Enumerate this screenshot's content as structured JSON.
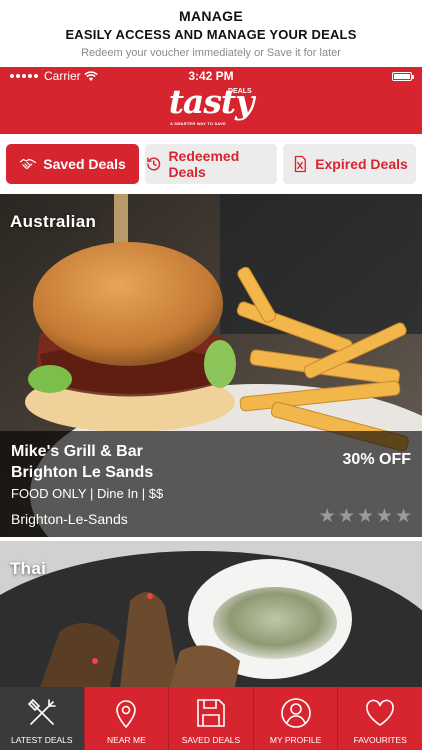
{
  "promo": {
    "heading": "MANAGE",
    "subheading": "EASILY ACCESS AND MANAGE YOUR DEALS",
    "description": "Redeem your voucher immediately or Save it for later"
  },
  "status_bar": {
    "carrier": "Carrier",
    "time": "3:42 PM"
  },
  "logo": {
    "word": "tasty",
    "badge": "DEALS",
    "tagline": "A SMARTER WAY TO SAVE"
  },
  "tabs": [
    {
      "label": "Saved Deals",
      "icon": "handshake-icon",
      "active": true
    },
    {
      "label": "Redeemed Deals",
      "icon": "history-icon",
      "active": false
    },
    {
      "label": "Expired Deals",
      "icon": "expired-voucher-icon",
      "active": false
    }
  ],
  "deals": [
    {
      "cuisine": "Australian",
      "name_line1": "Mike's Grill & Bar",
      "name_line2": "Brighton Le Sands",
      "meta": "FOOD ONLY | Dine In | $$",
      "location": "Brighton-Le-Sands",
      "discount": "30% OFF",
      "rating": 0
    },
    {
      "cuisine": "Thai"
    }
  ],
  "bottom_nav": [
    {
      "label": "LATEST DEALS",
      "icon": "fork-knife-icon",
      "active": true
    },
    {
      "label": "NEAR ME",
      "icon": "location-pin-icon",
      "active": false
    },
    {
      "label": "SAVED DEALS",
      "icon": "floppy-disk-icon",
      "active": false
    },
    {
      "label": "MY PROFILE",
      "icon": "user-icon",
      "active": false
    },
    {
      "label": "FAVOURITES",
      "icon": "heart-icon",
      "active": false
    }
  ],
  "colors": {
    "brand_red": "#d7252f",
    "tab_inactive": "#ececec",
    "nav_active": "#3a3a3a",
    "star_empty": "#9b9b9b"
  }
}
